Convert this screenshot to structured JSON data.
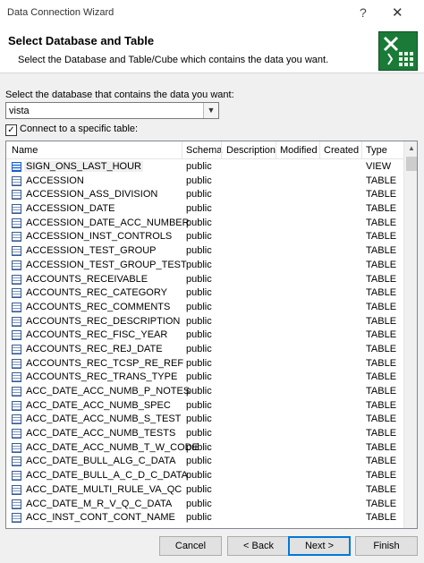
{
  "window": {
    "title": "Data Connection Wizard",
    "help_glyph": "?",
    "close_glyph": "✕"
  },
  "header": {
    "heading": "Select Database and Table",
    "subtext": "Select the Database and Table/Cube which contains the data you want."
  },
  "database": {
    "label": "Select the database that contains the data you want:",
    "value": "vista"
  },
  "connect_checkbox": {
    "checked": true,
    "label": "Connect to a specific table:"
  },
  "columns": [
    "Name",
    "Schema",
    "Description",
    "Modified",
    "Created",
    "Type"
  ],
  "rows": [
    {
      "name": "SIGN_ONS_LAST_HOUR",
      "schema": "public",
      "type": "VIEW",
      "icon": "view-icon"
    },
    {
      "name": "ACCESSION",
      "schema": "public",
      "type": "TABLE",
      "icon": "table-icon"
    },
    {
      "name": "ACCESSION_ASS_DIVISION",
      "schema": "public",
      "type": "TABLE",
      "icon": "table-icon"
    },
    {
      "name": "ACCESSION_DATE",
      "schema": "public",
      "type": "TABLE",
      "icon": "table-icon"
    },
    {
      "name": "ACCESSION_DATE_ACC_NUMBER",
      "schema": "public",
      "type": "TABLE",
      "icon": "table-icon"
    },
    {
      "name": "ACCESSION_INST_CONTROLS",
      "schema": "public",
      "type": "TABLE",
      "icon": "table-icon"
    },
    {
      "name": "ACCESSION_TEST_GROUP",
      "schema": "public",
      "type": "TABLE",
      "icon": "table-icon"
    },
    {
      "name": "ACCESSION_TEST_GROUP_TEST",
      "schema": "public",
      "type": "TABLE",
      "icon": "table-icon"
    },
    {
      "name": "ACCOUNTS_RECEIVABLE",
      "schema": "public",
      "type": "TABLE",
      "icon": "table-icon"
    },
    {
      "name": "ACCOUNTS_REC_CATEGORY",
      "schema": "public",
      "type": "TABLE",
      "icon": "table-icon"
    },
    {
      "name": "ACCOUNTS_REC_COMMENTS",
      "schema": "public",
      "type": "TABLE",
      "icon": "table-icon"
    },
    {
      "name": "ACCOUNTS_REC_DESCRIPTION",
      "schema": "public",
      "type": "TABLE",
      "icon": "table-icon"
    },
    {
      "name": "ACCOUNTS_REC_FISC_YEAR",
      "schema": "public",
      "type": "TABLE",
      "icon": "table-icon"
    },
    {
      "name": "ACCOUNTS_REC_REJ_DATE",
      "schema": "public",
      "type": "TABLE",
      "icon": "table-icon"
    },
    {
      "name": "ACCOUNTS_REC_TCSP_RE_REF",
      "schema": "public",
      "type": "TABLE",
      "icon": "table-icon"
    },
    {
      "name": "ACCOUNTS_REC_TRANS_TYPE",
      "schema": "public",
      "type": "TABLE",
      "icon": "table-icon"
    },
    {
      "name": "ACC_DATE_ACC_NUMB_P_NOTES",
      "schema": "public",
      "type": "TABLE",
      "icon": "table-icon"
    },
    {
      "name": "ACC_DATE_ACC_NUMB_SPEC",
      "schema": "public",
      "type": "TABLE",
      "icon": "table-icon"
    },
    {
      "name": "ACC_DATE_ACC_NUMB_S_TEST",
      "schema": "public",
      "type": "TABLE",
      "icon": "table-icon"
    },
    {
      "name": "ACC_DATE_ACC_NUMB_TESTS",
      "schema": "public",
      "type": "TABLE",
      "icon": "table-icon"
    },
    {
      "name": "ACC_DATE_ACC_NUMB_T_W_CODE",
      "schema": "public",
      "type": "TABLE",
      "icon": "table-icon"
    },
    {
      "name": "ACC_DATE_BULL_ALG_C_DATA",
      "schema": "public",
      "type": "TABLE",
      "icon": "table-icon"
    },
    {
      "name": "ACC_DATE_BULL_A_C_D_C_DATA",
      "schema": "public",
      "type": "TABLE",
      "icon": "table-icon"
    },
    {
      "name": "ACC_DATE_MULTI_RULE_VA_QC",
      "schema": "public",
      "type": "TABLE",
      "icon": "table-icon"
    },
    {
      "name": "ACC_DATE_M_R_V_Q_C_DATA",
      "schema": "public",
      "type": "TABLE",
      "icon": "table-icon"
    },
    {
      "name": "ACC_INST_CONT_CONT_NAME",
      "schema": "public",
      "type": "TABLE",
      "icon": "table-icon"
    }
  ],
  "buttons": {
    "cancel": "Cancel",
    "back": "< Back",
    "next": "Next >",
    "finish": "Finish"
  }
}
